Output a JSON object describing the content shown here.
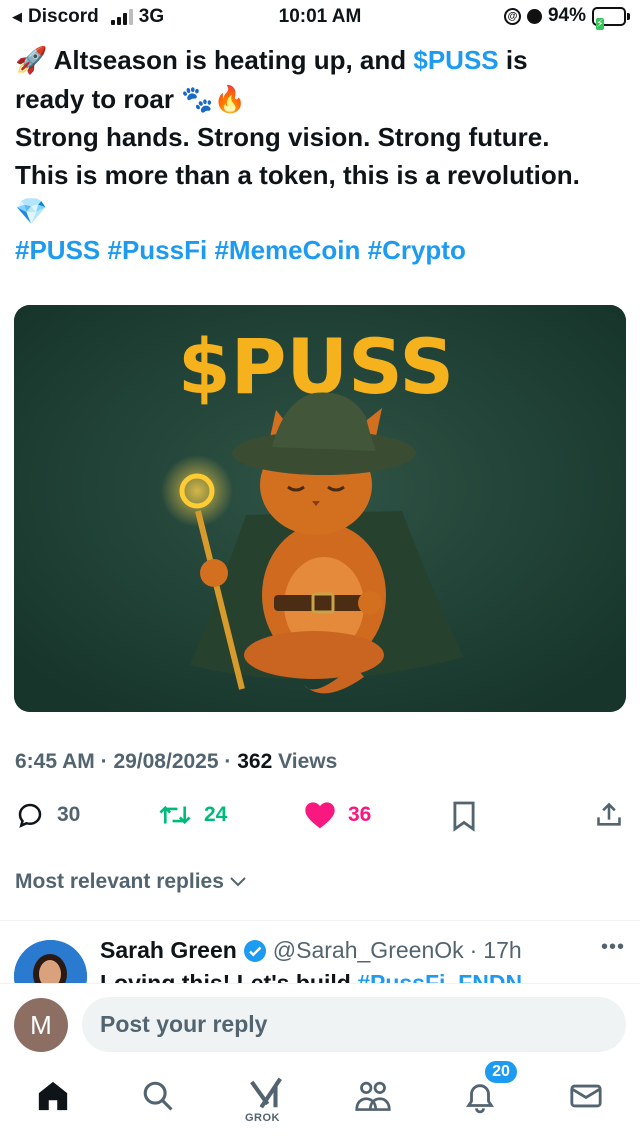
{
  "status_bar": {
    "back_app": "Discord",
    "network": "3G",
    "time": "10:01 AM",
    "battery": "94%",
    "ring_glyph": "@"
  },
  "tweet": {
    "line1_pre": "Altseason is heating up, and ",
    "cashtag": "$PUSS",
    "line1_post": " is",
    "line2": "ready to roar",
    "line3": "Strong hands. Strong vision. Strong future.",
    "line4": "This is more than a token, this is a revolution.",
    "hashtags": [
      "#PUSS",
      "#PussFi",
      "#MemeCoin",
      "#Crypto"
    ],
    "image_text": "$PUSS",
    "emoji": {
      "rocket": "🚀",
      "paws": "🐾",
      "fire": "🔥",
      "gem": "💎"
    }
  },
  "meta": {
    "time": "6:45 AM",
    "sep": "·",
    "date": "29/08/2025",
    "views_count": "362",
    "views_label": "Views"
  },
  "actions": {
    "replies": "30",
    "reposts": "24",
    "likes": "36",
    "colors": {
      "repost": "#00ba7c",
      "like": "#f91880",
      "muted": "#536471"
    }
  },
  "replies_sort": "Most relevant replies",
  "reply_preview": {
    "name": "Sarah Green",
    "handle": "@Sarah_GreenOk",
    "age": "17h",
    "text_pre": "Loving this! Let's build ",
    "text_link": "#PussFi_FNDN"
  },
  "composer": {
    "avatar_letter": "M",
    "placeholder": "Post your reply"
  },
  "tabbar": {
    "grok_label": "GROK",
    "notifications_badge": "20"
  },
  "colors": {
    "accent": "#1d9bf0",
    "muted": "#536471",
    "text": "#0f1419"
  }
}
